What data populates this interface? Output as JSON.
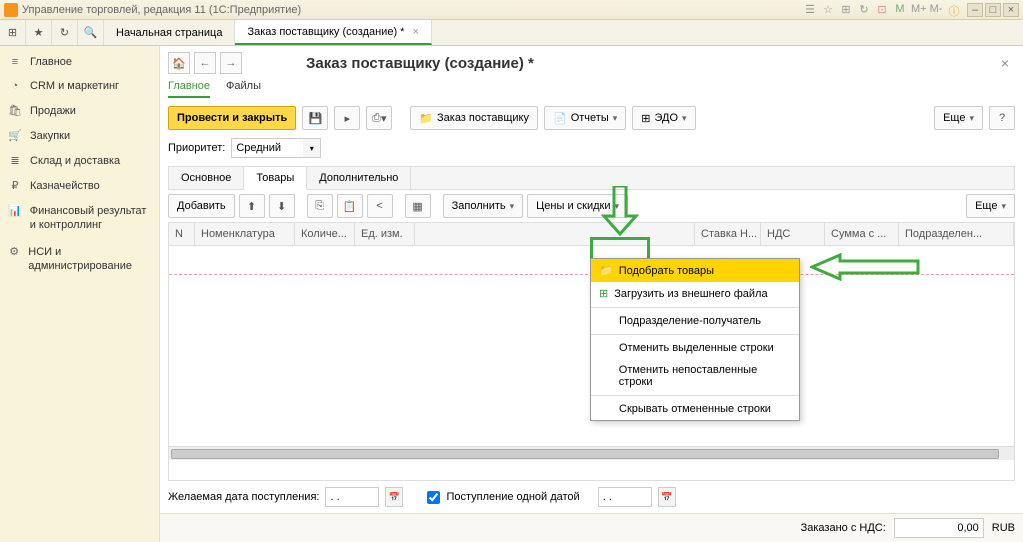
{
  "titlebar": {
    "text": "Управление торговлей, редакция 11   (1С:Предприятие)"
  },
  "tabs": {
    "home": "Начальная страница",
    "order": "Заказ поставщику (создание) *"
  },
  "sidebar": {
    "items": [
      {
        "icon": "≡",
        "label": "Главное"
      },
      {
        "icon": "◔",
        "label": "CRM и маркетинг"
      },
      {
        "icon": "🛍",
        "label": "Продажи"
      },
      {
        "icon": "🛒",
        "label": "Закупки"
      },
      {
        "icon": "≣",
        "label": "Склад и доставка"
      },
      {
        "icon": "₽",
        "label": "Казначейство"
      },
      {
        "icon": "📊",
        "label": "Финансовый результат и контроллинг"
      },
      {
        "icon": "⚙",
        "label": "НСИ и администрирование"
      }
    ]
  },
  "doc": {
    "title": "Заказ поставщику (создание) *",
    "sub_main": "Главное",
    "sub_files": "Файлы",
    "post_close": "Провести и закрыть",
    "supplier_order": "Заказ поставщику",
    "reports": "Отчеты",
    "edo": "ЭДО",
    "more": "Еще",
    "priority_label": "Приоритет:",
    "priority_value": "Средний",
    "tab_main": "Основное",
    "tab_goods": "Товары",
    "tab_extra": "Дополнительно",
    "add": "Добавить",
    "fill": "Заполнить",
    "prices": "Цены и скидки"
  },
  "fillmenu": {
    "pick": "Подобрать товары",
    "load": "Загрузить из внешнего файла",
    "dept": "Подразделение-получатель",
    "cancel_sel": "Отменить выделенные строки",
    "cancel_und": "Отменить непоставленные строки",
    "hide": "Скрывать отмененные строки"
  },
  "columns": {
    "n": "N",
    "nom": "Номенклатура",
    "qty": "Количе...",
    "unit": "Ед. изм.",
    "vat_rate": "Ставка Н...",
    "vat": "НДС",
    "sum": "Сумма с ...",
    "dept": "Подразделен..."
  },
  "footer": {
    "date_label": "Желаемая дата поступления:",
    "date_value": ". .",
    "single_date": "Поступление одной датой",
    "date_value2": ". .",
    "total_label": "Заказано с НДС:",
    "total_value": "0,00",
    "currency": "RUB"
  }
}
